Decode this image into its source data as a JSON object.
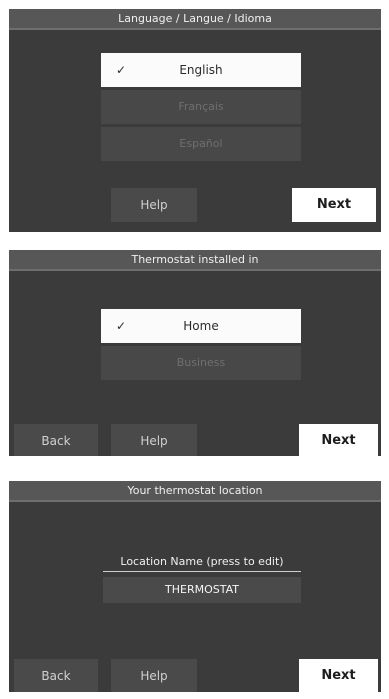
{
  "screens": [
    {
      "title": "Language / Langue / Idioma",
      "options": [
        {
          "label": "English",
          "selected": true
        },
        {
          "label": "Français",
          "selected": false
        },
        {
          "label": "Español",
          "selected": false
        }
      ],
      "help": "Help",
      "next": "Next"
    },
    {
      "title": "Thermostat installed in",
      "options": [
        {
          "label": "Home",
          "selected": true
        },
        {
          "label": "Business",
          "selected": false
        }
      ],
      "back": "Back",
      "help": "Help",
      "next": "Next"
    },
    {
      "title": "Your thermostat location",
      "location_label": "Location Name (press to edit)",
      "location_value": "THERMOSTAT",
      "back": "Back",
      "help": "Help",
      "next": "Next"
    }
  ],
  "icons": {
    "selected_check": "check-icon"
  }
}
